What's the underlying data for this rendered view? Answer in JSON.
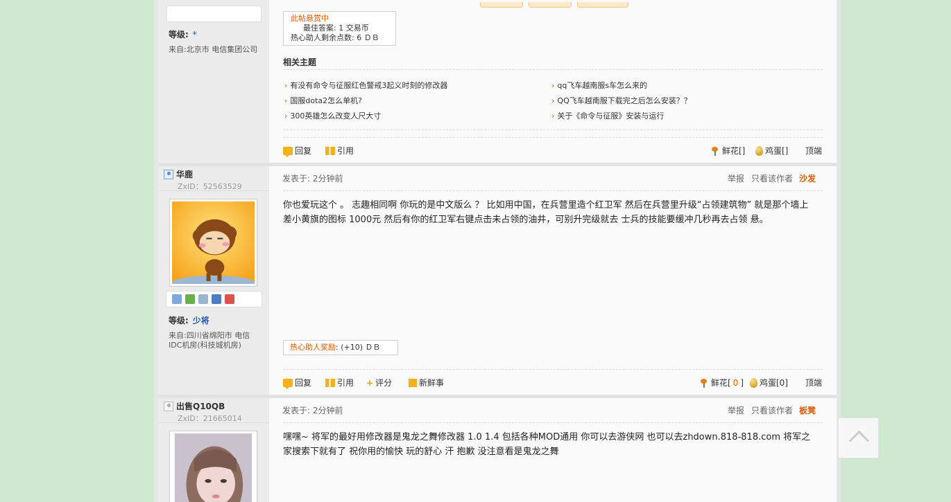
{
  "colors": {
    "accent": "#e05a00",
    "link": "#2a5aa8",
    "page_bg": "#cfe8d0"
  },
  "post0": {
    "level_label": "等级:",
    "level_value": "*",
    "from": "来自:北京市 电信集团公司",
    "reward": {
      "status": "此帖悬赏中",
      "best_answer": "最佳答案: 1 交易币",
      "helper_points": "热心助人剩余点数: 6 ＤＢ"
    },
    "related_title": "相关主题",
    "related": [
      "有没有命令与征服红色警戒3起义时刻的修改器",
      "qq飞车越南服s车怎么来的",
      "国服dota2怎么单机?",
      "QQ飞车越南服下载完之后怎么安装？？",
      "300英雄怎么改变人尺大寸",
      "关于《命令与征服》安装与运行"
    ],
    "actions": {
      "reply": "回复",
      "quote": "引用",
      "flower": "鲜花[]",
      "egg": "鸡蛋[]",
      "top": "顶端"
    }
  },
  "post1": {
    "username": "华鹿",
    "zxid": "ZxID：52563529",
    "level_label": "等级:",
    "level_value": "少将",
    "from": "来自:四川省绵阳市 电信IDC机房(科技城机房)",
    "posted": "发表于: 2分钟前",
    "report": "举报",
    "only_author": "只看该作者",
    "floor": "沙发",
    "content": "你也爱玩这个 。 志趣相同啊 你玩的是中文版么 ？ 比如用中国，在兵营里造个红卫军 然后在兵营里升级“占领建筑物” 就是那个墙上差小黄旗的图标 1000元 然后有你的红卫军右键点击未占领的油井，可别升完级就去 士兵的技能要缓冲几秒再去占领 悬。",
    "reward_label": "热心助人奖励",
    "reward_value": ": (+10) ＤＢ",
    "actions": {
      "reply": "回复",
      "quote": "引用",
      "rate": "评分",
      "news": "新鲜事",
      "flower": "鲜花[",
      "flower_count": "0",
      "flower_end": "]",
      "egg": "鸡蛋[0]",
      "top": "顶端"
    }
  },
  "post2": {
    "username": "出售Q10QB",
    "zxid": "ZxID：21665014",
    "posted": "发表于: 2分钟前",
    "report": "举报",
    "only_author": "只看该作者",
    "floor": "板凳",
    "content": "嘿嘿~ 将军的最好用修改器是鬼龙之舞修改器 1.0 1.4 包括各种MOD通用 你可以去游侠网 也可以去zhdown.818-818.com 将军之家搜索下就有了 祝你用的愉快 玩的舒心 汗 抱歉 没注意看是鬼龙之舞"
  }
}
